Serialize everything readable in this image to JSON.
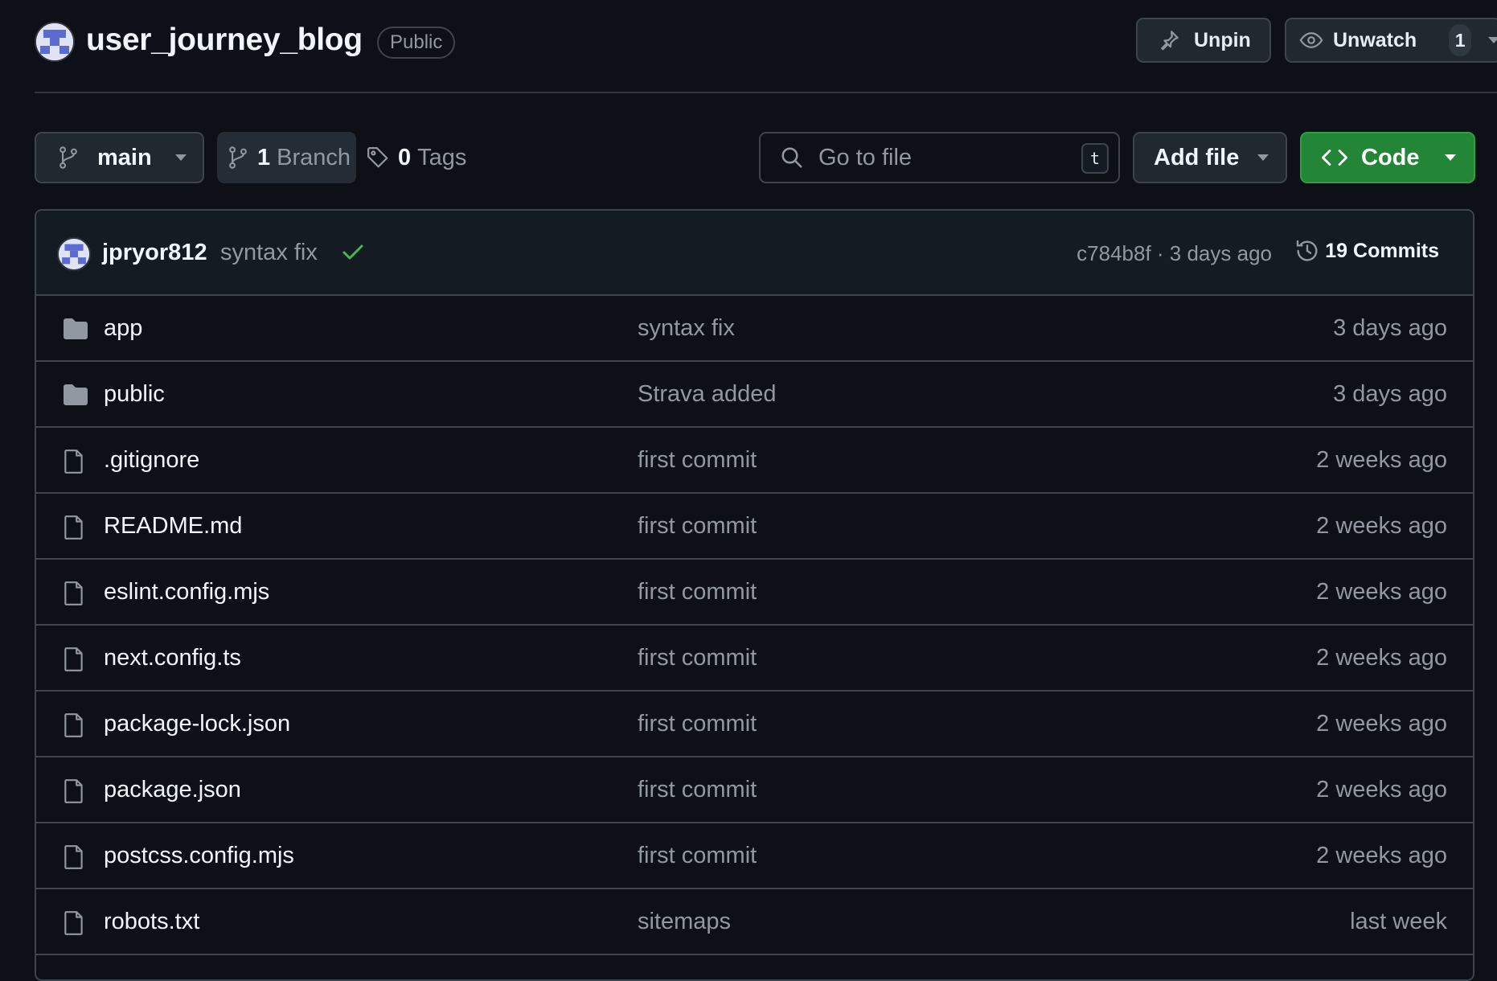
{
  "repo": {
    "name": "user_journey_blog",
    "visibility": "Public"
  },
  "header": {
    "unpin_label": "Unpin",
    "unwatch_label": "Unwatch",
    "watch_count": "1"
  },
  "toolbar": {
    "branch": "main",
    "branch_count": "1",
    "branch_label": "Branch",
    "tag_count": "0",
    "tag_label": "Tags",
    "search_placeholder": "Go to file",
    "search_shortcut": "t",
    "add_file_label": "Add file",
    "code_label": "Code"
  },
  "latest_commit": {
    "author": "jpryor812",
    "message": "syntax fix",
    "status": "success",
    "meta": "c784b8f · 3 days ago",
    "commits_label": "19 Commits"
  },
  "files": [
    {
      "name": "app",
      "type": "dir",
      "message": "syntax fix",
      "time": "3 days ago"
    },
    {
      "name": "public",
      "type": "dir",
      "message": "Strava added",
      "time": "3 days ago"
    },
    {
      "name": ".gitignore",
      "type": "file",
      "message": "first commit",
      "time": "2 weeks ago"
    },
    {
      "name": "README.md",
      "type": "file",
      "message": "first commit",
      "time": "2 weeks ago"
    },
    {
      "name": "eslint.config.mjs",
      "type": "file",
      "message": "first commit",
      "time": "2 weeks ago"
    },
    {
      "name": "next.config.ts",
      "type": "file",
      "message": "first commit",
      "time": "2 weeks ago"
    },
    {
      "name": "package-lock.json",
      "type": "file",
      "message": "first commit",
      "time": "2 weeks ago"
    },
    {
      "name": "package.json",
      "type": "file",
      "message": "first commit",
      "time": "2 weeks ago"
    },
    {
      "name": "postcss.config.mjs",
      "type": "file",
      "message": "first commit",
      "time": "2 weeks ago"
    },
    {
      "name": "robots.txt",
      "type": "file",
      "message": "sitemaps",
      "time": "last week"
    }
  ],
  "colors": {
    "background": "#0d1117",
    "border": "#3d444d",
    "primary_button": "#238636",
    "success_check": "#3fb950"
  }
}
